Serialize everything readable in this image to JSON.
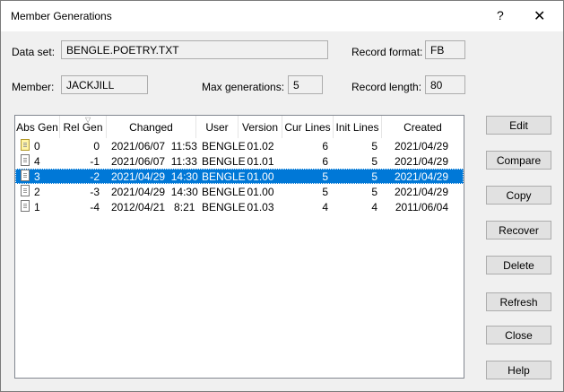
{
  "dialog": {
    "title": "Member Generations",
    "help": "?",
    "close": "✕"
  },
  "fields": {
    "data_set_label": "Data set:",
    "data_set_value": "BENGLE.POETRY.TXT",
    "record_format_label": "Record format:",
    "record_format_value": "FB",
    "member_label": "Member:",
    "member_value": "JACKJILL",
    "max_gen_label": "Max generations:",
    "max_gen_value": "5",
    "record_length_label": "Record length:",
    "record_length_value": "80"
  },
  "table": {
    "headers": [
      "Abs Gen",
      "Rel Gen",
      "Changed",
      "User",
      "Version",
      "Cur Lines",
      "Init Lines",
      "Created"
    ],
    "sorted_column": "Rel Gen",
    "rows": [
      {
        "abs": "0",
        "rel": "0",
        "changed": "2021/06/07  11:53",
        "user": "BENGLE",
        "version": "01.02",
        "cur": "6",
        "init": "5",
        "created": "2021/04/29",
        "icon": "document-yellow-icon",
        "selected": false
      },
      {
        "abs": "4",
        "rel": "-1",
        "changed": "2021/06/07  11:33",
        "user": "BENGLE",
        "version": "01.01",
        "cur": "6",
        "init": "5",
        "created": "2021/04/29",
        "icon": "document-icon",
        "selected": false
      },
      {
        "abs": "3",
        "rel": "-2",
        "changed": "2021/04/29  14:30",
        "user": "BENGLE",
        "version": "01.00",
        "cur": "5",
        "init": "5",
        "created": "2021/04/29",
        "icon": "document-icon",
        "selected": true
      },
      {
        "abs": "2",
        "rel": "-3",
        "changed": "2021/04/29  14:30",
        "user": "BENGLE",
        "version": "01.00",
        "cur": "5",
        "init": "5",
        "created": "2021/04/29",
        "icon": "document-icon",
        "selected": false
      },
      {
        "abs": "1",
        "rel": "-4",
        "changed": "2012/04/21   8:21",
        "user": "BENGLE",
        "version": "01.03",
        "cur": "4",
        "init": "4",
        "created": "2011/06/04",
        "icon": "document-icon",
        "selected": false
      }
    ]
  },
  "buttons": {
    "edit": "Edit",
    "compare": "Compare",
    "copy": "Copy",
    "recover": "Recover",
    "delete": "Delete",
    "refresh": "Refresh",
    "close": "Close",
    "help": "Help"
  },
  "colors": {
    "selection": "#0078d7",
    "dialog_bg": "#f0f0f0"
  }
}
